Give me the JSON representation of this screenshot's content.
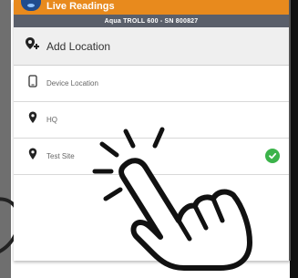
{
  "app": {
    "title": "Live Readings",
    "device_line": "Aqua TROLL 600 - SN 800827"
  },
  "actions": {
    "add_location_label": "Add Location"
  },
  "locations": [
    {
      "label": "Device Location",
      "icon": "phone-location-icon",
      "selected": false
    },
    {
      "label": "HQ",
      "icon": "map-pin-icon",
      "selected": false
    },
    {
      "label": "Test Site",
      "icon": "map-pin-icon",
      "selected": true
    }
  ],
  "colors": {
    "title_bar": "#e88a1d",
    "sub_bar": "#5a5f6a",
    "selected_check": "#3bb34a"
  },
  "overlay": {
    "gesture_icon": "tap-hand-icon"
  }
}
